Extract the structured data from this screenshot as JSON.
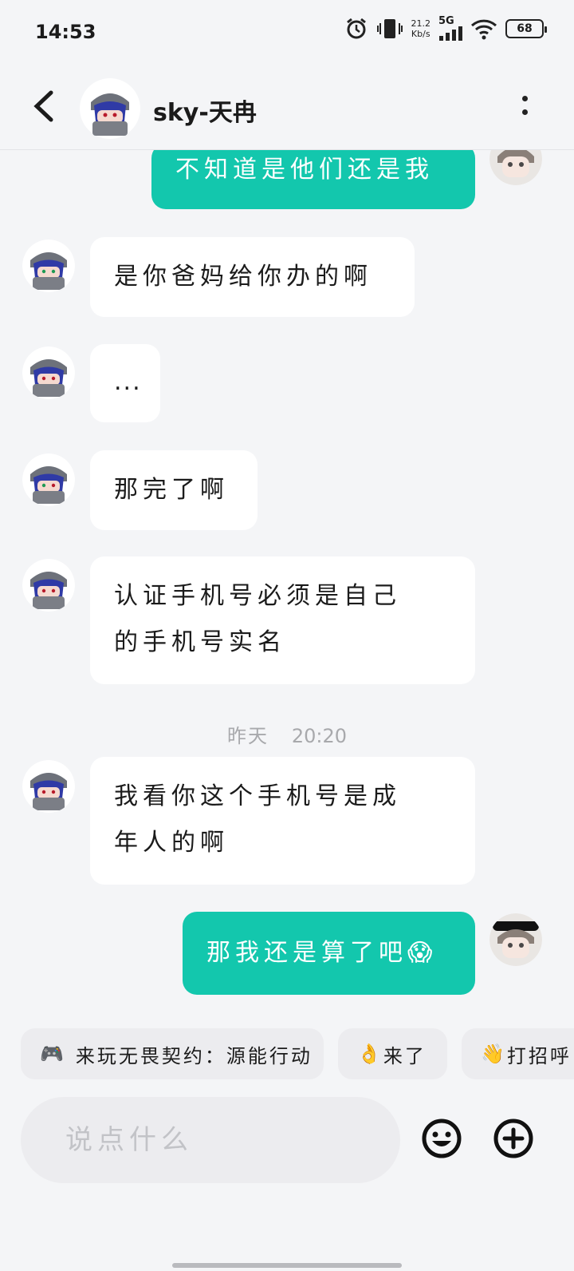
{
  "status_bar": {
    "time": "14:53",
    "net_speed_value": "21.2",
    "net_speed_unit": "Kb/s",
    "network": "5G",
    "battery": "68"
  },
  "header": {
    "contact_name": "sky-天冉"
  },
  "messages": [
    {
      "side": "out",
      "text": "不知道是他们还是我"
    },
    {
      "side": "in",
      "text": "是你爸妈给你办的啊"
    },
    {
      "side": "in",
      "text": "..."
    },
    {
      "side": "in",
      "text": "那完了啊"
    },
    {
      "side": "in",
      "lines": [
        "认证手机号必须是自己",
        "的手机号实名"
      ]
    },
    {
      "side": "in",
      "lines": [
        "我看你这个手机号是成",
        "年人的啊"
      ]
    },
    {
      "side": "out",
      "text": "那我还是算了吧😱"
    }
  ],
  "timestamp": {
    "day": "昨天",
    "time": "20:20"
  },
  "quick_replies": [
    {
      "emoji": "🎮",
      "label": "来玩无畏契约：源能行动"
    },
    {
      "emoji": "👌",
      "label": "来了"
    },
    {
      "emoji": "👋",
      "label": "打招呼"
    }
  ],
  "composer": {
    "placeholder": "说点什么"
  },
  "icons": {
    "back": "back-arrow-icon",
    "more": "more-vertical-icon",
    "emoji": "emoji-icon",
    "add": "add-circle-icon"
  },
  "colors": {
    "outgoing_bubble": "#13c7ad",
    "incoming_bubble": "#ffffff",
    "background": "#f4f5f7"
  }
}
